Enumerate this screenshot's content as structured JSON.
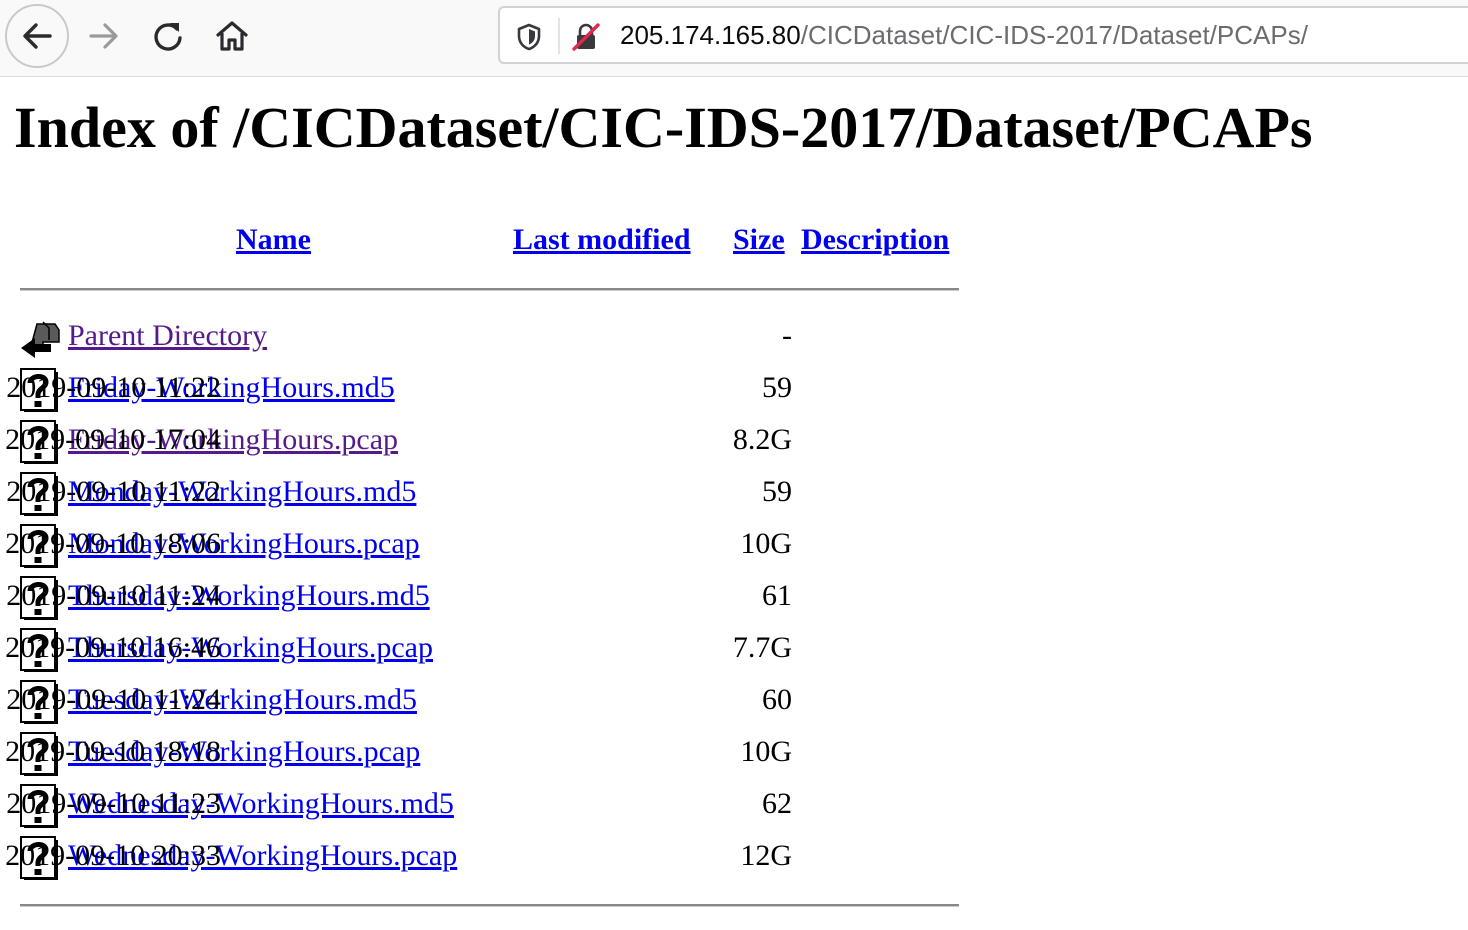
{
  "browser": {
    "url_host": "205.174.165.80",
    "url_path": "/CICDataset/CIC-IDS-2017/Dataset/PCAPs/"
  },
  "page": {
    "title": "Index of /CICDataset/CIC-IDS-2017/Dataset/PCAPs"
  },
  "columns": {
    "name": "Name",
    "last_modified": "Last modified",
    "size": "Size",
    "description": "Description"
  },
  "rows": [
    {
      "icon": "back-arrow-icon",
      "name": "Parent Directory",
      "modified": "",
      "size": "-",
      "visited": true
    },
    {
      "icon": "unknown-file-icon",
      "name": "Friday-WorkingHours.md5",
      "modified": "2019-09-10 11:22",
      "size": "59",
      "visited": false
    },
    {
      "icon": "unknown-file-icon",
      "name": "Friday-WorkingHours.pcap",
      "modified": "2019-09-10 17:04",
      "size": "8.2G",
      "visited": true
    },
    {
      "icon": "unknown-file-icon",
      "name": "Monday-WorkingHours.md5",
      "modified": "2019-09-10 11:22",
      "size": "59",
      "visited": false
    },
    {
      "icon": "unknown-file-icon",
      "name": "Monday-WorkingHours.pcap",
      "modified": "2019-09-10 18:06",
      "size": "10G",
      "visited": false
    },
    {
      "icon": "unknown-file-icon",
      "name": "Thursday-WorkingHours.md5",
      "modified": "2019-09-10 11:24",
      "size": "61",
      "visited": false
    },
    {
      "icon": "unknown-file-icon",
      "name": "Thursday-WorkingHours.pcap",
      "modified": "2019-09-10 16:46",
      "size": "7.7G",
      "visited": false
    },
    {
      "icon": "unknown-file-icon",
      "name": "Tuesday-WorkingHours.md5",
      "modified": "2019-09-10 11:24",
      "size": "60",
      "visited": false
    },
    {
      "icon": "unknown-file-icon",
      "name": "Tuesday-WorkingHours.pcap",
      "modified": "2019-09-10 18:18",
      "size": "10G",
      "visited": false
    },
    {
      "icon": "unknown-file-icon",
      "name": "Wednesday-WorkingHours.md5",
      "modified": "2019-09-10 11:23",
      "size": "62",
      "visited": false
    },
    {
      "icon": "unknown-file-icon",
      "name": "Wednesday-WorkingHours.pcap",
      "modified": "2019-09-10 20:33",
      "size": "12G",
      "visited": false
    }
  ],
  "colors": {
    "link": "#0000ee",
    "visited_link": "#551a8b",
    "insecure_red": "#e22850"
  }
}
